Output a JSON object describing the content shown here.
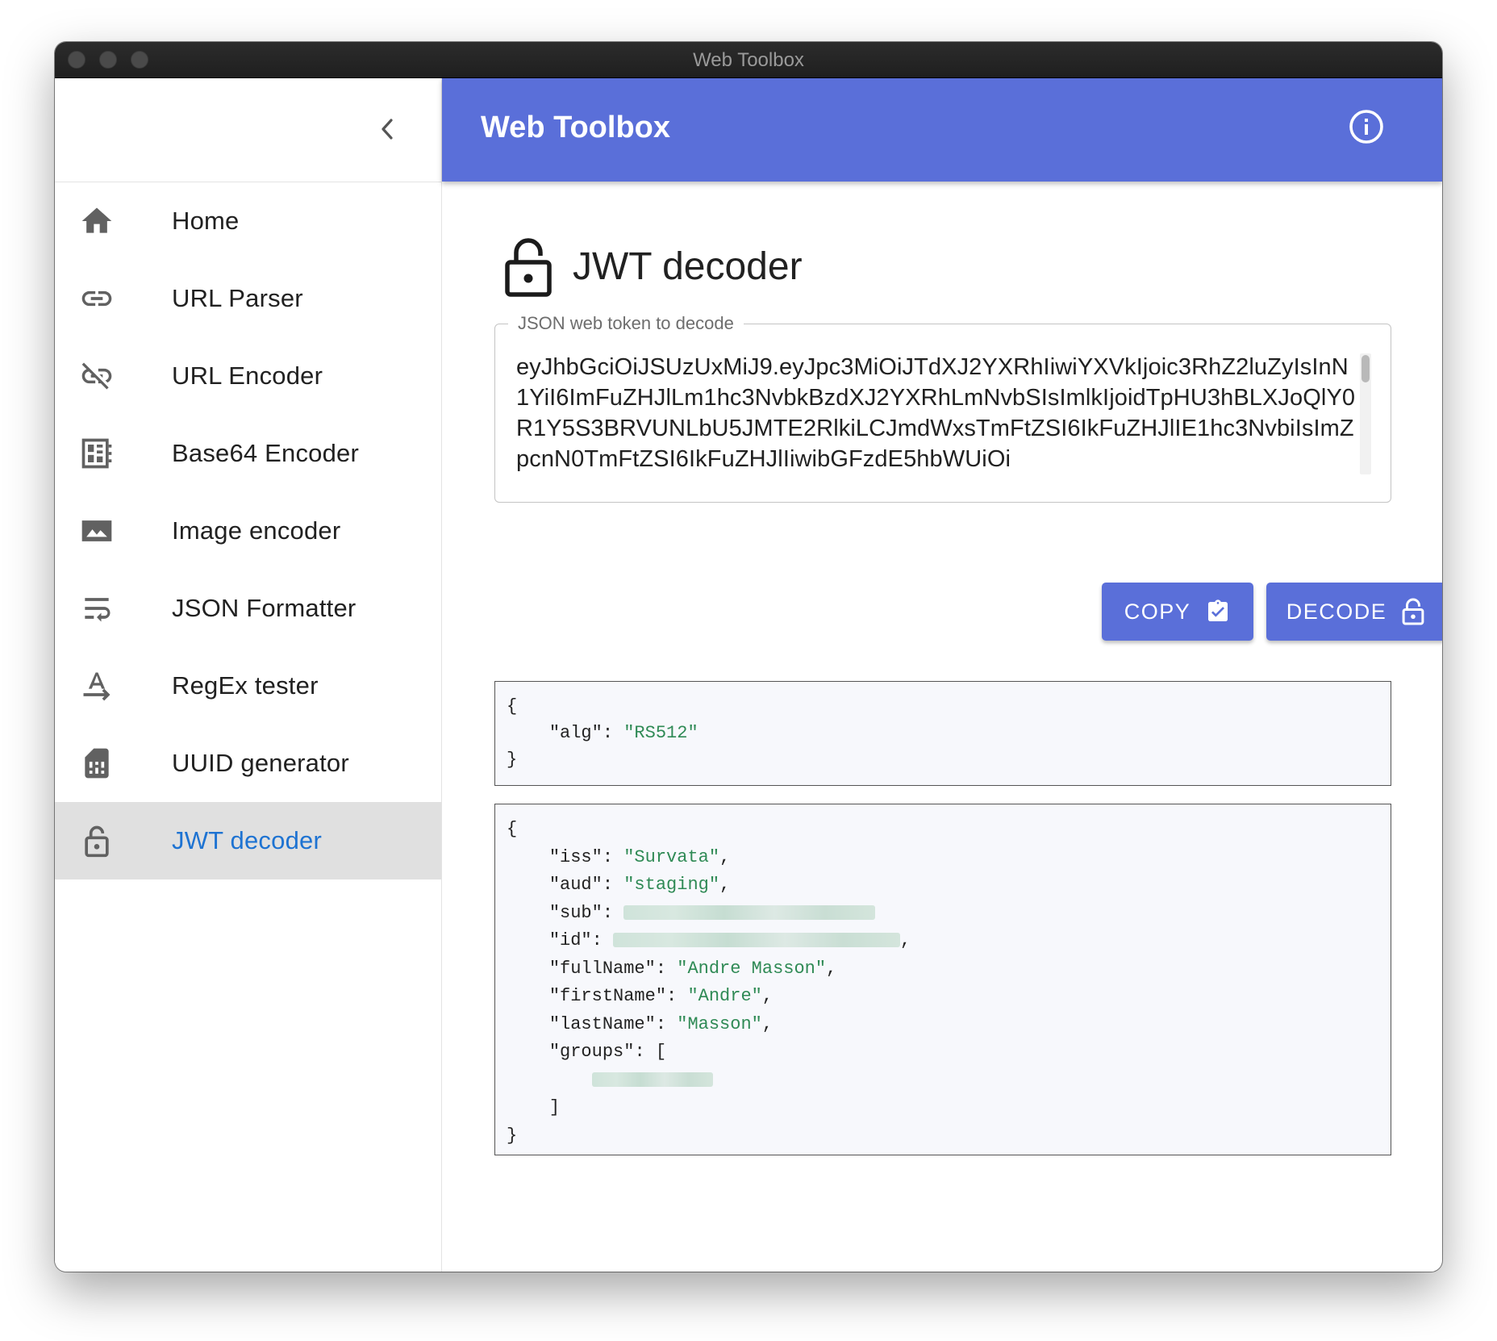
{
  "window": {
    "title": "Web Toolbox"
  },
  "appbar": {
    "title": "Web Toolbox",
    "info_icon": "info-icon"
  },
  "sidebar": {
    "collapse_icon": "chevron-left-icon",
    "items": [
      {
        "label": "Home",
        "icon": "home-icon"
      },
      {
        "label": "URL Parser",
        "icon": "link-icon"
      },
      {
        "label": "URL Encoder",
        "icon": "link-off-icon"
      },
      {
        "label": "Base64 Encoder",
        "icon": "base64-icon"
      },
      {
        "label": "Image encoder",
        "icon": "image-icon"
      },
      {
        "label": "JSON Formatter",
        "icon": "wrap-text-icon"
      },
      {
        "label": "RegEx tester",
        "icon": "text-rotation-icon"
      },
      {
        "label": "UUID generator",
        "icon": "sim-card-icon"
      },
      {
        "label": "JWT decoder",
        "icon": "lock-open-icon",
        "active": true
      }
    ]
  },
  "page": {
    "title": "JWT decoder",
    "title_icon": "lock-open-icon",
    "token_field": {
      "label": "JSON web token to decode",
      "value": "eyJhbGciOiJSUzUxMiJ9.eyJpc3MiOiJTdXJ2YXRhIiwiYXVkIjoic3RhZ2luZyIsInN1YiI6ImFuZHJlLm1hc3NvbkBzdXJ2YXRhLmNvbSIsImlkIjoidTpHU3hBLXJoQlY0R1Y5S3BRVUNLbU5JMTE2RlkiLCJmdWxsTmFtZSI6IkFuZHJlIE1hc3NvbiIsImZpcnN0TmFtZSI6IkFuZHJlIiwibGFzdE5hbWUiOi"
    },
    "buttons": {
      "copy": {
        "label": "COPY",
        "icon": "clipboard-check-icon"
      },
      "decode": {
        "label": "DECODE",
        "icon": "lock-open-icon"
      }
    },
    "header_json": {
      "open": "{",
      "alg_key": "\"alg\"",
      "alg_value": "\"RS512\"",
      "close": "}"
    },
    "payload_json": {
      "open": "{",
      "iss_key": "\"iss\"",
      "iss_value": "\"Survata\"",
      "aud_key": "\"aud\"",
      "aud_value": "\"staging\"",
      "sub_key": "\"sub\"",
      "id_key": "\"id\"",
      "fullName_key": "\"fullName\"",
      "fullName_value": "\"Andre Masson\"",
      "firstName_key": "\"firstName\"",
      "firstName_value": "\"Andre\"",
      "lastName_key": "\"lastName\"",
      "lastName_value": "\"Masson\"",
      "groups_key": "\"groups\"",
      "array_open": "[",
      "array_close": "]",
      "close": "}"
    }
  },
  "colors": {
    "accent": "#5a6fd9",
    "active_link": "#1e73d2",
    "json_string": "#2f8a55",
    "active_item_bg": "#e0e0e0"
  }
}
